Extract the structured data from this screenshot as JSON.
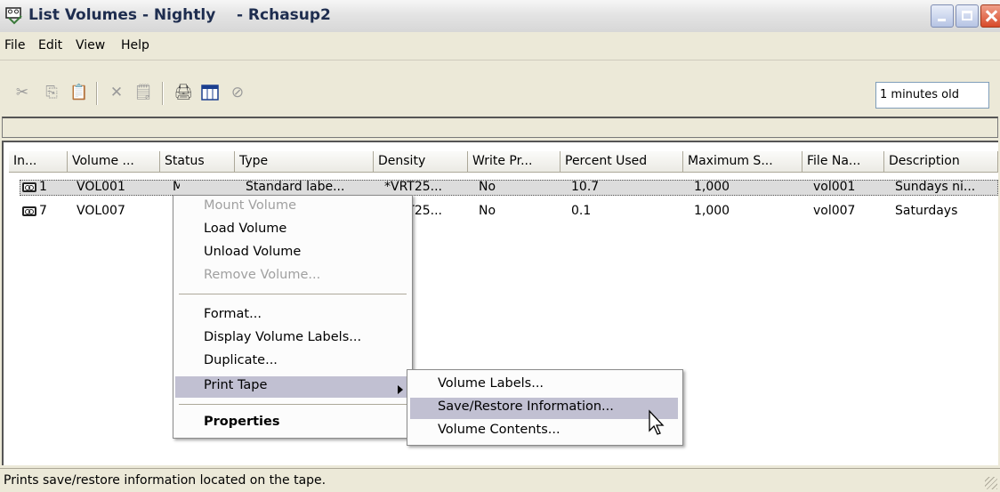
{
  "window": {
    "title": "List Volumes - Nightly    - Rchasup2"
  },
  "menu": [
    "File",
    "Edit",
    "View",
    "Help"
  ],
  "toolbar": {
    "icons": [
      "cut-icon",
      "copy-icon",
      "paste-icon",
      "delete-icon",
      "properties-icon",
      "print-icon",
      "columns-icon",
      "stop-icon"
    ],
    "age_text": "1 minutes old"
  },
  "table": {
    "columns": [
      "In...",
      "Volume ...",
      "Status",
      "Type",
      "Density",
      "Write Pr...",
      "Percent Used",
      "Maximum S...",
      "File Na...",
      "Description"
    ],
    "rows": [
      {
        "index": "1",
        "volume": "VOL001",
        "status": "Mou...",
        "type": "Standard labe...",
        "density": "*VRT25...",
        "write_protect": "No",
        "percent_used": "10.7",
        "maximum_size": "1,000",
        "file_name": "vol001",
        "description": "Sundays ni..."
      },
      {
        "index": "7",
        "volume": "VOL007",
        "status": "",
        "type": "",
        "density": "*VRT25...",
        "write_protect": "No",
        "percent_used": "0.1",
        "maximum_size": "1,000",
        "file_name": "vol007",
        "description": "Saturdays"
      }
    ]
  },
  "context_menu": {
    "items": [
      {
        "label": "Mount Volume",
        "enabled": false
      },
      {
        "label": "Load Volume",
        "enabled": true
      },
      {
        "label": "Unload Volume",
        "enabled": true
      },
      {
        "label": "Remove Volume...",
        "enabled": false
      },
      {
        "label": "Format...",
        "enabled": true
      },
      {
        "label": "Display Volume Labels...",
        "enabled": true
      },
      {
        "label": "Duplicate...",
        "enabled": true
      },
      {
        "label": "Print Tape",
        "enabled": true
      },
      {
        "label": "Properties",
        "enabled": true
      }
    ],
    "submenu": [
      "Volume Labels...",
      "Save/Restore Information...",
      "Volume Contents..."
    ]
  },
  "status_bar": {
    "text": "Prints save/restore information located on the tape."
  },
  "colors": {
    "menu_highlight": "#c1c0d2",
    "window_bg": "#ece9d8",
    "close_button": "#d84a2a"
  }
}
